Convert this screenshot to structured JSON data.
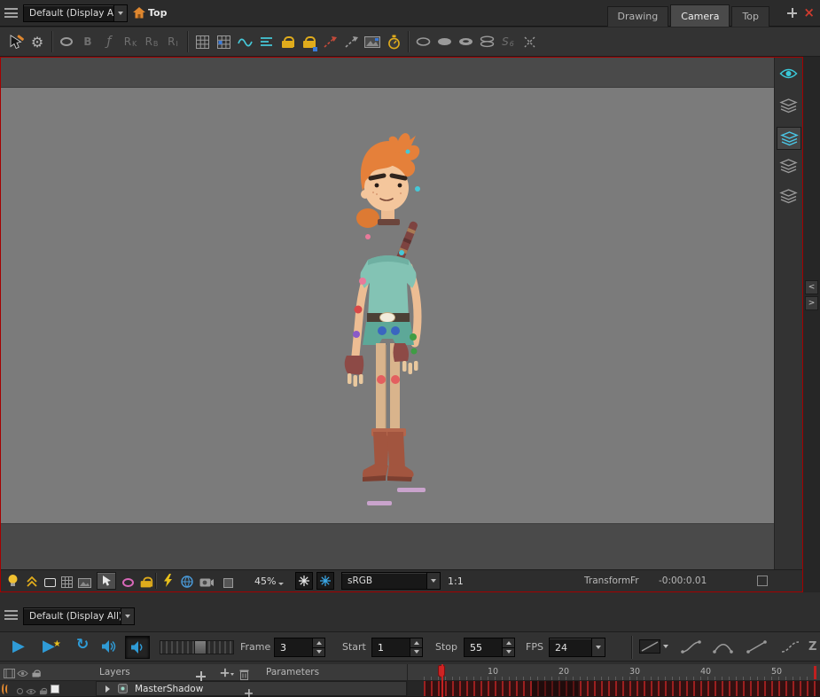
{
  "top_bar": {
    "display_dropdown": "Default (Display All)",
    "view_label": "Top",
    "tabs": [
      {
        "label": "Drawing"
      },
      {
        "label": "Camera"
      },
      {
        "label": "Top"
      }
    ]
  },
  "tool_toolbar": {
    "letters": [
      {
        "main": "B",
        "sub": ""
      },
      {
        "main": "ƒ",
        "sub": ""
      },
      {
        "main": "R",
        "sub": "K"
      },
      {
        "main": "R",
        "sub": "B"
      },
      {
        "main": "R",
        "sub": "I"
      },
      {
        "main": "S",
        "sub": "6"
      }
    ]
  },
  "camera_view": {
    "zoom": "45%",
    "color_space": "sRGB",
    "aspect": "1:1",
    "tool_name": "Transform",
    "frame_abbr": "Fr",
    "timecode": "-0:00:0.01"
  },
  "playback": {
    "frame_label": "Frame",
    "frame_value": "3",
    "start_label": "Start",
    "start_value": "1",
    "stop_label": "Stop",
    "stop_value": "55",
    "fps_label": "FPS",
    "fps_value": "24"
  },
  "timeline": {
    "display_dropdown": "Default (Display All)",
    "layers_label": "Layers",
    "parameters_label": "Parameters",
    "ruler_ticks": [
      "10",
      "20",
      "30",
      "40",
      "50"
    ],
    "layers": [
      {
        "name": "MasterShadow"
      }
    ]
  },
  "colors": {
    "active_view_border": "#a40000",
    "stage_gray": "#7b7b7b",
    "accent_blue": "#2f9bd6",
    "accent_yellow": "#e0ac1c"
  }
}
